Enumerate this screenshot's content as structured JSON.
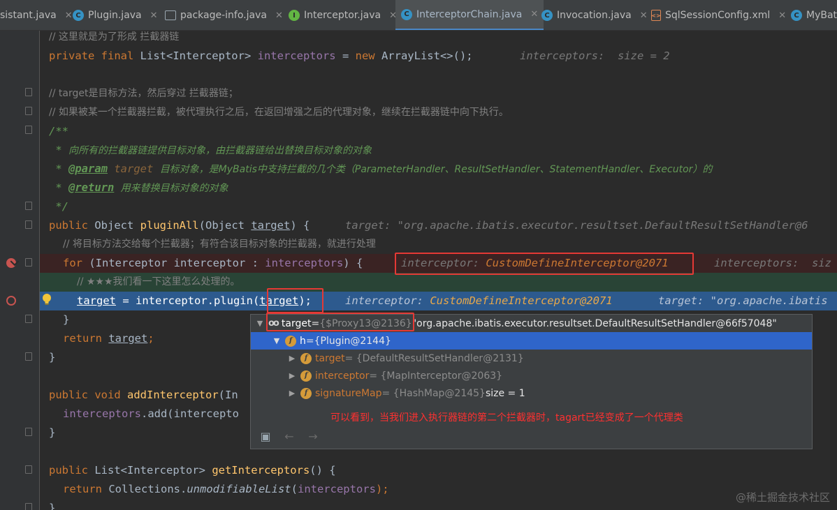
{
  "tabs": [
    {
      "label": "sistant.java",
      "icon": "class-icon"
    },
    {
      "label": "Plugin.java",
      "icon": "class-icon"
    },
    {
      "label": "package-info.java",
      "icon": "package-icon"
    },
    {
      "label": "Interceptor.java",
      "icon": "interface-icon"
    },
    {
      "label": "InterceptorChain.java",
      "icon": "class-icon",
      "active": true
    },
    {
      "label": "Invocation.java",
      "icon": "class-icon"
    },
    {
      "label": "SqlSessionConfig.xml",
      "icon": "xml-icon"
    },
    {
      "label": "MyBat",
      "icon": "class-icon"
    }
  ],
  "code": {
    "l1": "// 这里就是为了形成 拦截器链",
    "l2_kw": "private final",
    "l2_type": " List<Interceptor> ",
    "l2_field": "interceptors",
    "l2_rest": " = ",
    "l2_new": "new",
    "l2_end": " ArrayList<>();",
    "l2_inline": "interceptors:  size = 2",
    "l4": "// target是目标方法，然后穿过 拦截器链；",
    "l5": "// 如果被某一个拦截器拦截，被代理执行之后，在返回增强之后的代理对象，继续在拦截器链中向下执行。",
    "l6": "/**",
    "l7_star": " * ",
    "l7_text": "向所有的拦截器链提供目标对象，由拦截器链给出替换目标对象的对象",
    "l8_star": " * ",
    "l8_tag": "@param",
    "l8_param": "target",
    "l8_text": "目标对象，是MyBatis中支持拦截的几个类（ParameterHandler、ResultSetHandler、StatementHandler、Executor）的",
    "l9_star": " * ",
    "l9_tag": "@return",
    "l9_text": "用来替换目标对象的对象",
    "l10": " */",
    "l11_kw": "public",
    "l11_a": " Object ",
    "l11_fn": "pluginAll",
    "l11_b": "(Object ",
    "l11_p": "target",
    "l11_c": ") {",
    "l11_inline": "target: \"org.apache.ibatis.executor.resultset.DefaultResultSetHandler@6",
    "l12": "// 将目标方法交给每个拦截器；有符合该目标对象的拦截器，就进行处理",
    "l13_kw": "for",
    "l13_a": " (Interceptor interceptor : ",
    "l13_f": "interceptors",
    "l13_b": ") {",
    "l13_inline_k": "interceptor: ",
    "l13_inline_v": "CustomDefineInterceptor@2071",
    "l13_inline2": "interceptors:  siz",
    "l14": "// ★★★我们看一下这里怎么处理的。",
    "l15_a": "target",
    "l15_b": " = interceptor.plugin(",
    "l15_c": "target",
    "l15_d": ");",
    "l15_inline_k": "interceptor: ",
    "l15_inline_v": "CustomDefineInterceptor@2071",
    "l15_inline2": "target: \"org.apache.ibatis",
    "l16": "}",
    "l17_kw": "return",
    "l17_v": "target",
    "l17_end": ";",
    "l18": "}",
    "l20_kw": "public void",
    "l20_fn": "addInterceptor",
    "l20_rest": "(In",
    "l21_f": "interceptors",
    "l21_rest": ".add(intercepto",
    "l22": "}",
    "l24_kw": "public",
    "l24_a": " List<Interceptor> ",
    "l24_fn": "getInterceptors",
    "l24_b": "() {",
    "l25_kw": "return",
    "l25_a": " Collections.",
    "l25_it": "unmodifiableList",
    "l25_b": "(",
    "l25_f": "interceptors",
    "l25_c": ");",
    "l26": "}"
  },
  "popup": {
    "row1_name": "target",
    "row1_eq": " = ",
    "row1_ref": "{$Proxy13@2136}",
    "row1_str": " \"org.apache.ibatis.executor.resultset.DefaultResultSetHandler@66f57048\"",
    "row2_name": "h",
    "row2_eq": " = ",
    "row2_ref": "{Plugin@2144}",
    "row3_name": "target",
    "row3_ref": " = {DefaultResultSetHandler@2131}",
    "row4_name": "interceptor",
    "row4_ref": " = {MapInterceptor@2063}",
    "row5_name": "signatureMap",
    "row5_ref": " = {HashMap@2145}",
    "row5_extra": "  size = 1",
    "note": "可以看到，当我们进入执行器链的第二个拦截器时，tagart已经变成了一个代理类"
  },
  "watermark": "@稀土掘金技术社区"
}
